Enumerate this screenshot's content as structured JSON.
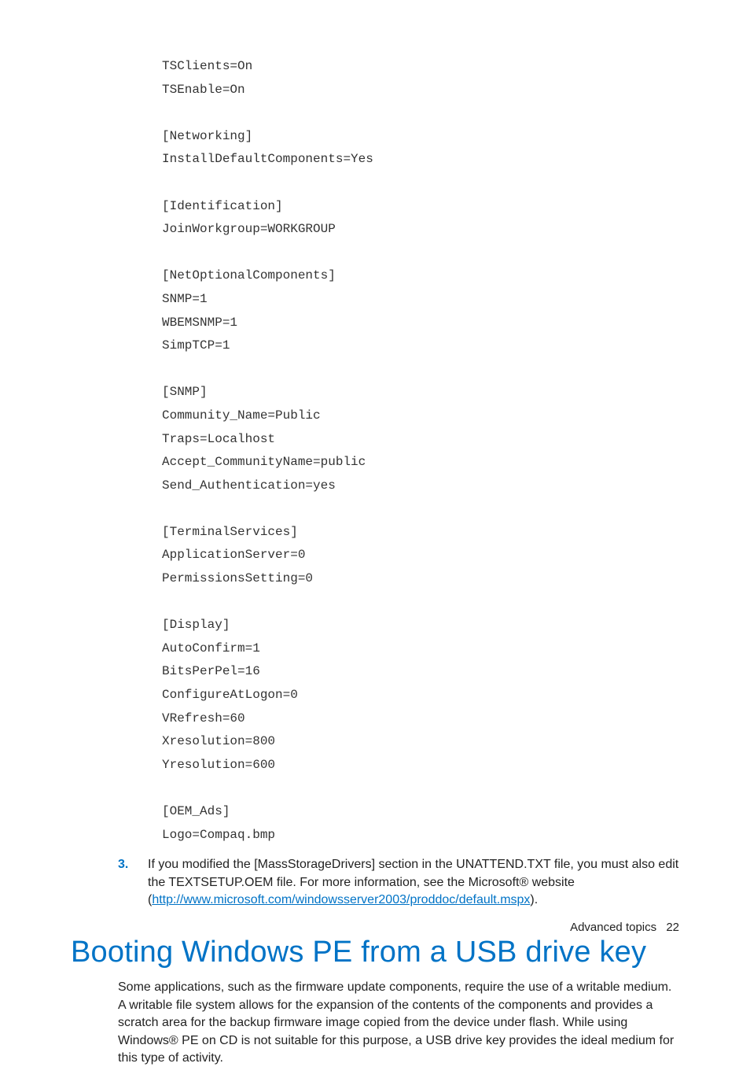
{
  "code": "TSClients=On\nTSEnable=On\n\n[Networking]\nInstallDefaultComponents=Yes\n\n[Identification]\nJoinWorkgroup=WORKGROUP\n\n[NetOptionalComponents]\nSNMP=1\nWBEMSNMP=1\nSimpTCP=1\n\n[SNMP]\nCommunity_Name=Public\nTraps=Localhost\nAccept_CommunityName=public\nSend_Authentication=yes\n\n[TerminalServices]\nApplicationServer=0\nPermissionsSetting=0\n\n[Display]\nAutoConfirm=1\nBitsPerPel=16\nConfigureAtLogon=0\nVRefresh=60\nXresolution=800\nYresolution=600\n\n[OEM_Ads]\nLogo=Compaq.bmp",
  "step": {
    "num": "3.",
    "text_before_link": "If you modified the [MassStorageDrivers] section in the UNATTEND.TXT file, you must also edit the TEXTSETUP.OEM file. For more information, see the Microsoft® website (",
    "link_text": "http://www.microsoft.com/windowsserver2003/proddoc/default.mspx",
    "text_after_link": ")."
  },
  "heading": "Booting Windows PE from a USB drive key",
  "paragraph": "Some applications, such as the firmware update components, require the use of a writable medium. A writable file system allows for the expansion of the contents of the components and provides a scratch area for the backup firmware image copied from the device under flash. While using Windows® PE on CD is not suitable for this purpose, a USB drive key provides the ideal medium for this type of activity.",
  "footer": {
    "section": "Advanced topics",
    "page": "22"
  }
}
